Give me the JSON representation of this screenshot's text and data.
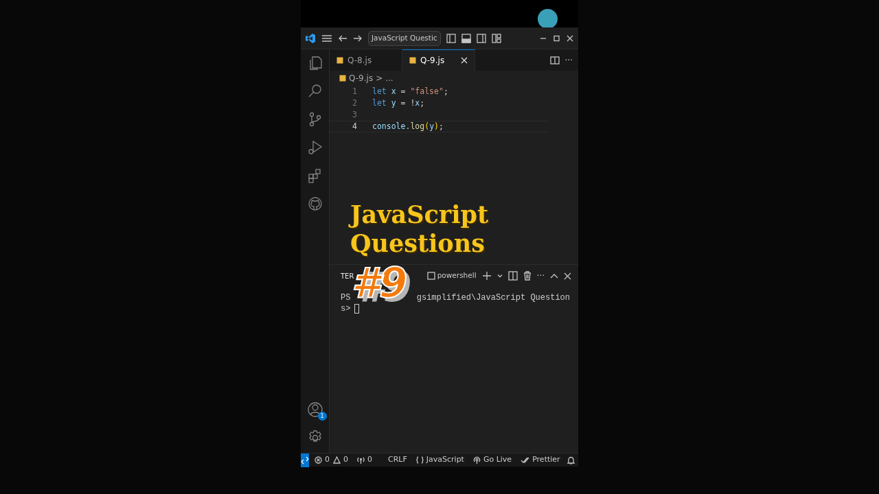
{
  "title_bar": {
    "command_center": "JavaScript Questic"
  },
  "tabs": [
    {
      "label": "Q-8.js",
      "selected": false
    },
    {
      "label": "Q-9.js",
      "selected": true
    }
  ],
  "editor_actions": {
    "more": "···"
  },
  "breadcrumb": {
    "file": "Q-9.js",
    "separator": ">",
    "rest": "..."
  },
  "code_lines": [
    {
      "number": "1",
      "current": false,
      "tokens": [
        {
          "kind": "keyword",
          "text": "let"
        },
        {
          "kind": "variable",
          "text": " x"
        },
        {
          "kind": "plain",
          "text": " = "
        },
        {
          "kind": "string",
          "text": "\"false\""
        },
        {
          "kind": "plain",
          "text": ";"
        }
      ]
    },
    {
      "number": "2",
      "current": false,
      "tokens": [
        {
          "kind": "keyword",
          "text": "let"
        },
        {
          "kind": "variable",
          "text": " y"
        },
        {
          "kind": "plain",
          "text": " = !"
        },
        {
          "kind": "variable",
          "text": "x"
        },
        {
          "kind": "plain",
          "text": ";"
        }
      ]
    },
    {
      "number": "3",
      "current": false
    },
    {
      "number": "4",
      "current": true,
      "tokens": [
        {
          "kind": "variable",
          "text": "console"
        },
        {
          "kind": "plain",
          "text": "."
        },
        {
          "kind": "function",
          "text": "log"
        },
        {
          "kind": "paren",
          "text": "("
        },
        {
          "kind": "variable",
          "text": "y"
        },
        {
          "kind": "paren",
          "text": ")"
        },
        {
          "kind": "plain",
          "text": ";"
        }
      ]
    }
  ],
  "overlay": {
    "title_lines": [
      "JavaScript",
      "Questions"
    ],
    "number": "#9"
  },
  "terminal": {
    "tab": {
      "label": "TER",
      "selected": true
    },
    "shell": "powershell",
    "more": "···",
    "lines": [
      {
        "segments": [
          "PS",
          "gsimplified\\JavaScript Question"
        ],
        "cursor": false
      },
      {
        "segments": [
          "s>"
        ],
        "cursor": true
      }
    ]
  },
  "activity_bar": {
    "account_badge": "1"
  },
  "status_bar": {
    "errors": "0",
    "warnings": "0",
    "ports": "0",
    "line_ending": "CRLF",
    "language": "JavaScript",
    "live": "Go Live",
    "formatter": "Prettier"
  }
}
